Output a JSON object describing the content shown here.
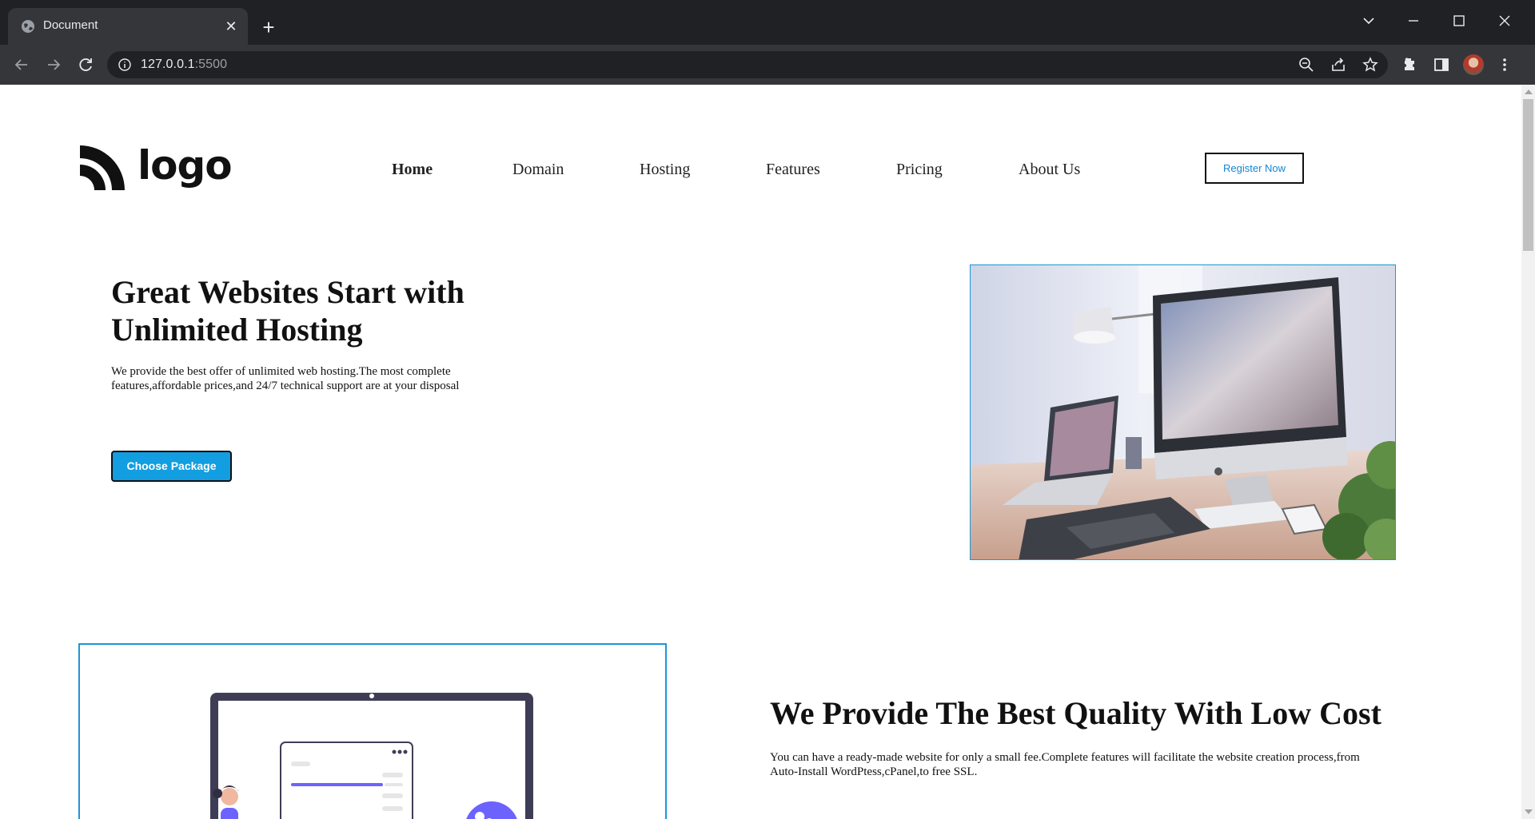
{
  "browser": {
    "tab_title": "Document",
    "url_host": "127.0.0.1",
    "url_port": ":5500"
  },
  "header": {
    "logo_text": "logo",
    "nav": [
      "Home",
      "Domain",
      "Hosting",
      "Features",
      "Pricing",
      "About Us"
    ],
    "active_nav": "Home",
    "register_label": "Register Now"
  },
  "hero": {
    "title": "Great Websites Start with Unlimited Hosting",
    "text": "We provide the best offer of unlimited web hosting.The most complete features,affordable prices,and 24/7 technical support are at your disposal",
    "button_label": "Choose Package"
  },
  "section2": {
    "title": "We Provide The Best Quality With Low Cost",
    "text": "You can have a ready-made website for only a small fee.Complete features will facilitate the website creation process,from Auto-Install WordPtess,cPanel,to free SSL."
  },
  "colors": {
    "accent": "#129ee0",
    "border_accent": "#1b97d5",
    "chrome_dark": "#202124",
    "chrome_toolbar": "#35363a"
  }
}
